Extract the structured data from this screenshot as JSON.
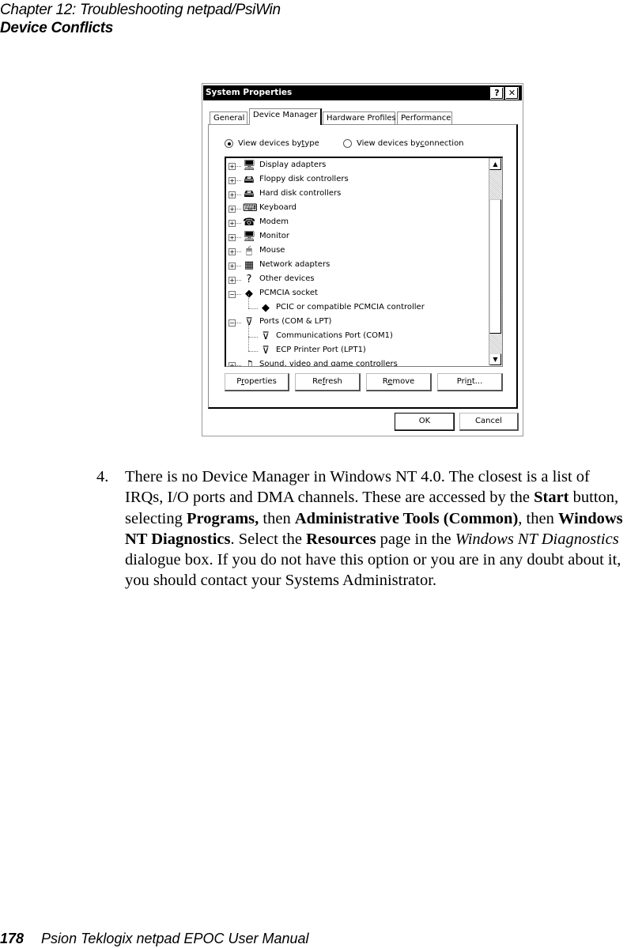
{
  "page": {
    "chapter_header": "Chapter 12:  Troubleshooting netpad/PsiWin",
    "section_header": "Device Conflicts",
    "footer": {
      "page_number": "178",
      "manual_title": "Psion Teklogix netpad EPOC User Manual"
    }
  },
  "dialog": {
    "title": "System Properties",
    "help_button": "?",
    "close_button": "✕",
    "tabs": [
      {
        "label": "General",
        "active": false
      },
      {
        "label": "Device Manager",
        "active": true
      },
      {
        "label": "Hardware Profiles",
        "active": false
      },
      {
        "label": "Performance",
        "active": false
      }
    ],
    "view_options": [
      {
        "pre": "View devices by ",
        "accel": "t",
        "post": "ype",
        "selected": true
      },
      {
        "pre": "View devices by ",
        "accel": "c",
        "post": "onnection",
        "selected": false
      }
    ],
    "device_tree": [
      {
        "label": "Display adapters",
        "icon": "monitor-icon",
        "glyph": "🖥",
        "level": 0,
        "expander": "+"
      },
      {
        "label": "Floppy disk controllers",
        "icon": "disk-controller-icon",
        "glyph": "🖴",
        "level": 0,
        "expander": "+"
      },
      {
        "label": "Hard disk controllers",
        "icon": "disk-controller-icon",
        "glyph": "🖴",
        "level": 0,
        "expander": "+"
      },
      {
        "label": "Keyboard",
        "icon": "keyboard-icon",
        "glyph": "⌨",
        "level": 0,
        "expander": "+"
      },
      {
        "label": "Modem",
        "icon": "modem-icon",
        "glyph": "☎",
        "level": 0,
        "expander": "+"
      },
      {
        "label": "Monitor",
        "icon": "monitor-icon",
        "glyph": "🖥",
        "level": 0,
        "expander": "+"
      },
      {
        "label": "Mouse",
        "icon": "mouse-icon",
        "glyph": "🖱",
        "level": 0,
        "expander": "+"
      },
      {
        "label": "Network adapters",
        "icon": "network-adapter-icon",
        "glyph": "▦",
        "level": 0,
        "expander": "+"
      },
      {
        "label": "Other devices",
        "icon": "question-mark-icon",
        "glyph": "?",
        "level": 0,
        "expander": "+"
      },
      {
        "label": "PCMCIA socket",
        "icon": "pcmcia-icon",
        "glyph": "◆",
        "level": 0,
        "expander": "−"
      },
      {
        "label": "PCIC or compatible PCMCIA controller",
        "icon": "pcmcia-warning-icon",
        "glyph": "◆",
        "level": 1,
        "expander": ""
      },
      {
        "label": "Ports (COM & LPT)",
        "icon": "port-icon",
        "glyph": "⊽",
        "level": 0,
        "expander": "−"
      },
      {
        "label": "Communications Port (COM1)",
        "icon": "port-icon",
        "glyph": "⊽",
        "level": 1,
        "expander": ""
      },
      {
        "label": "ECP Printer Port (LPT1)",
        "icon": "port-icon",
        "glyph": "⊽",
        "level": 1,
        "expander": ""
      },
      {
        "label": "Sound, video and game controllers",
        "icon": "sound-icon",
        "glyph": "♫",
        "level": 0,
        "expander": "+"
      }
    ],
    "scroll_up": "▲",
    "scroll_down": "▼",
    "action_buttons": [
      {
        "pre": "P",
        "accel": "r",
        "post": "operties"
      },
      {
        "pre": "Re",
        "accel": "f",
        "post": "resh"
      },
      {
        "pre": "R",
        "accel": "e",
        "post": "move"
      },
      {
        "pre": "Pri",
        "accel": "n",
        "post": "t..."
      }
    ],
    "ok_label": "OK",
    "cancel_label": "Cancel"
  },
  "body_text": {
    "step_number": "4.",
    "segments": [
      {
        "text": "There is no Device Manager in Windows NT 4.0. The closest is a list of IRQs, I/O ports and DMA channels. These are accessed by the ",
        "style": "normal"
      },
      {
        "text": "Start",
        "style": "bold"
      },
      {
        "text": " button, selecting ",
        "style": "normal"
      },
      {
        "text": "Programs,",
        "style": "bold"
      },
      {
        "text": " then ",
        "style": "normal"
      },
      {
        "text": "Administrative Tools (Common)",
        "style": "bold"
      },
      {
        "text": ", then ",
        "style": "normal"
      },
      {
        "text": "Windows NT Diagnostics",
        "style": "bold"
      },
      {
        "text": ". Select the ",
        "style": "normal"
      },
      {
        "text": "Resources",
        "style": "bold"
      },
      {
        "text": " page in the ",
        "style": "normal"
      },
      {
        "text": "Windows NT Diagnostics",
        "style": "italic"
      },
      {
        "text": " dialogue box. If you do not have this option or you are in any doubt about it, you should contact your Systems Administrator.",
        "style": "normal"
      }
    ]
  }
}
